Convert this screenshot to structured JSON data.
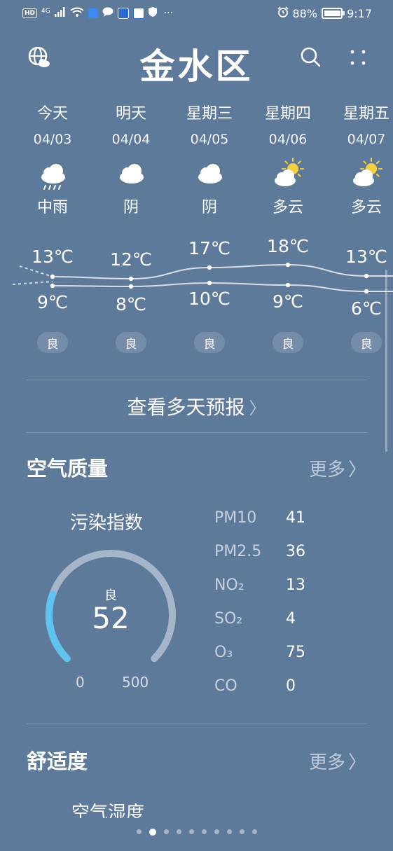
{
  "status_bar": {
    "hd": "HD",
    "network": "4G",
    "battery": "88%",
    "time": "9:17",
    "more": "···"
  },
  "header": {
    "city": "金水区"
  },
  "forecast": [
    {
      "day": "今天",
      "date": "04/03",
      "condition": "中雨",
      "icon": "rain-cloud-icon",
      "high": "13℃",
      "low": "9℃",
      "aqi": "良"
    },
    {
      "day": "明天",
      "date": "04/04",
      "condition": "阴",
      "icon": "cloud-icon",
      "high": "12℃",
      "low": "8℃",
      "aqi": "良"
    },
    {
      "day": "星期三",
      "date": "04/05",
      "condition": "阴",
      "icon": "cloud-icon",
      "high": "17℃",
      "low": "10℃",
      "aqi": "良"
    },
    {
      "day": "星期四",
      "date": "04/06",
      "condition": "多云",
      "icon": "partly-cloudy-icon",
      "high": "18℃",
      "low": "9℃",
      "aqi": "良"
    },
    {
      "day": "星期五",
      "date": "04/07",
      "condition": "多云",
      "icon": "partly-cloudy-icon",
      "high": "13℃",
      "low": "6℃",
      "aqi": "良"
    }
  ],
  "more_days": "查看多天预报",
  "air_quality": {
    "title": "空气质量",
    "more": "更多",
    "index_label": "污染指数",
    "level": "良",
    "value": "52",
    "min": "0",
    "max": "500",
    "value_fraction": 0.104,
    "pollutants": [
      {
        "name": "PM10",
        "value": "41"
      },
      {
        "name": "PM2.5",
        "value": "36"
      },
      {
        "name": "NO₂",
        "value": "13"
      },
      {
        "name": "SO₂",
        "value": "4"
      },
      {
        "name": "O₃",
        "value": "75"
      },
      {
        "name": "CO",
        "value": "0"
      }
    ]
  },
  "comfort": {
    "title": "舒适度",
    "more": "更多",
    "subtitle": "空气湿度"
  },
  "pager": {
    "count": 10,
    "active": 1
  },
  "colors": {
    "background": "#5e7a9b",
    "gauge_track": "#a6b5c8",
    "gauge_fill": "#5fc3ef",
    "sun": "#f7cf3a"
  }
}
